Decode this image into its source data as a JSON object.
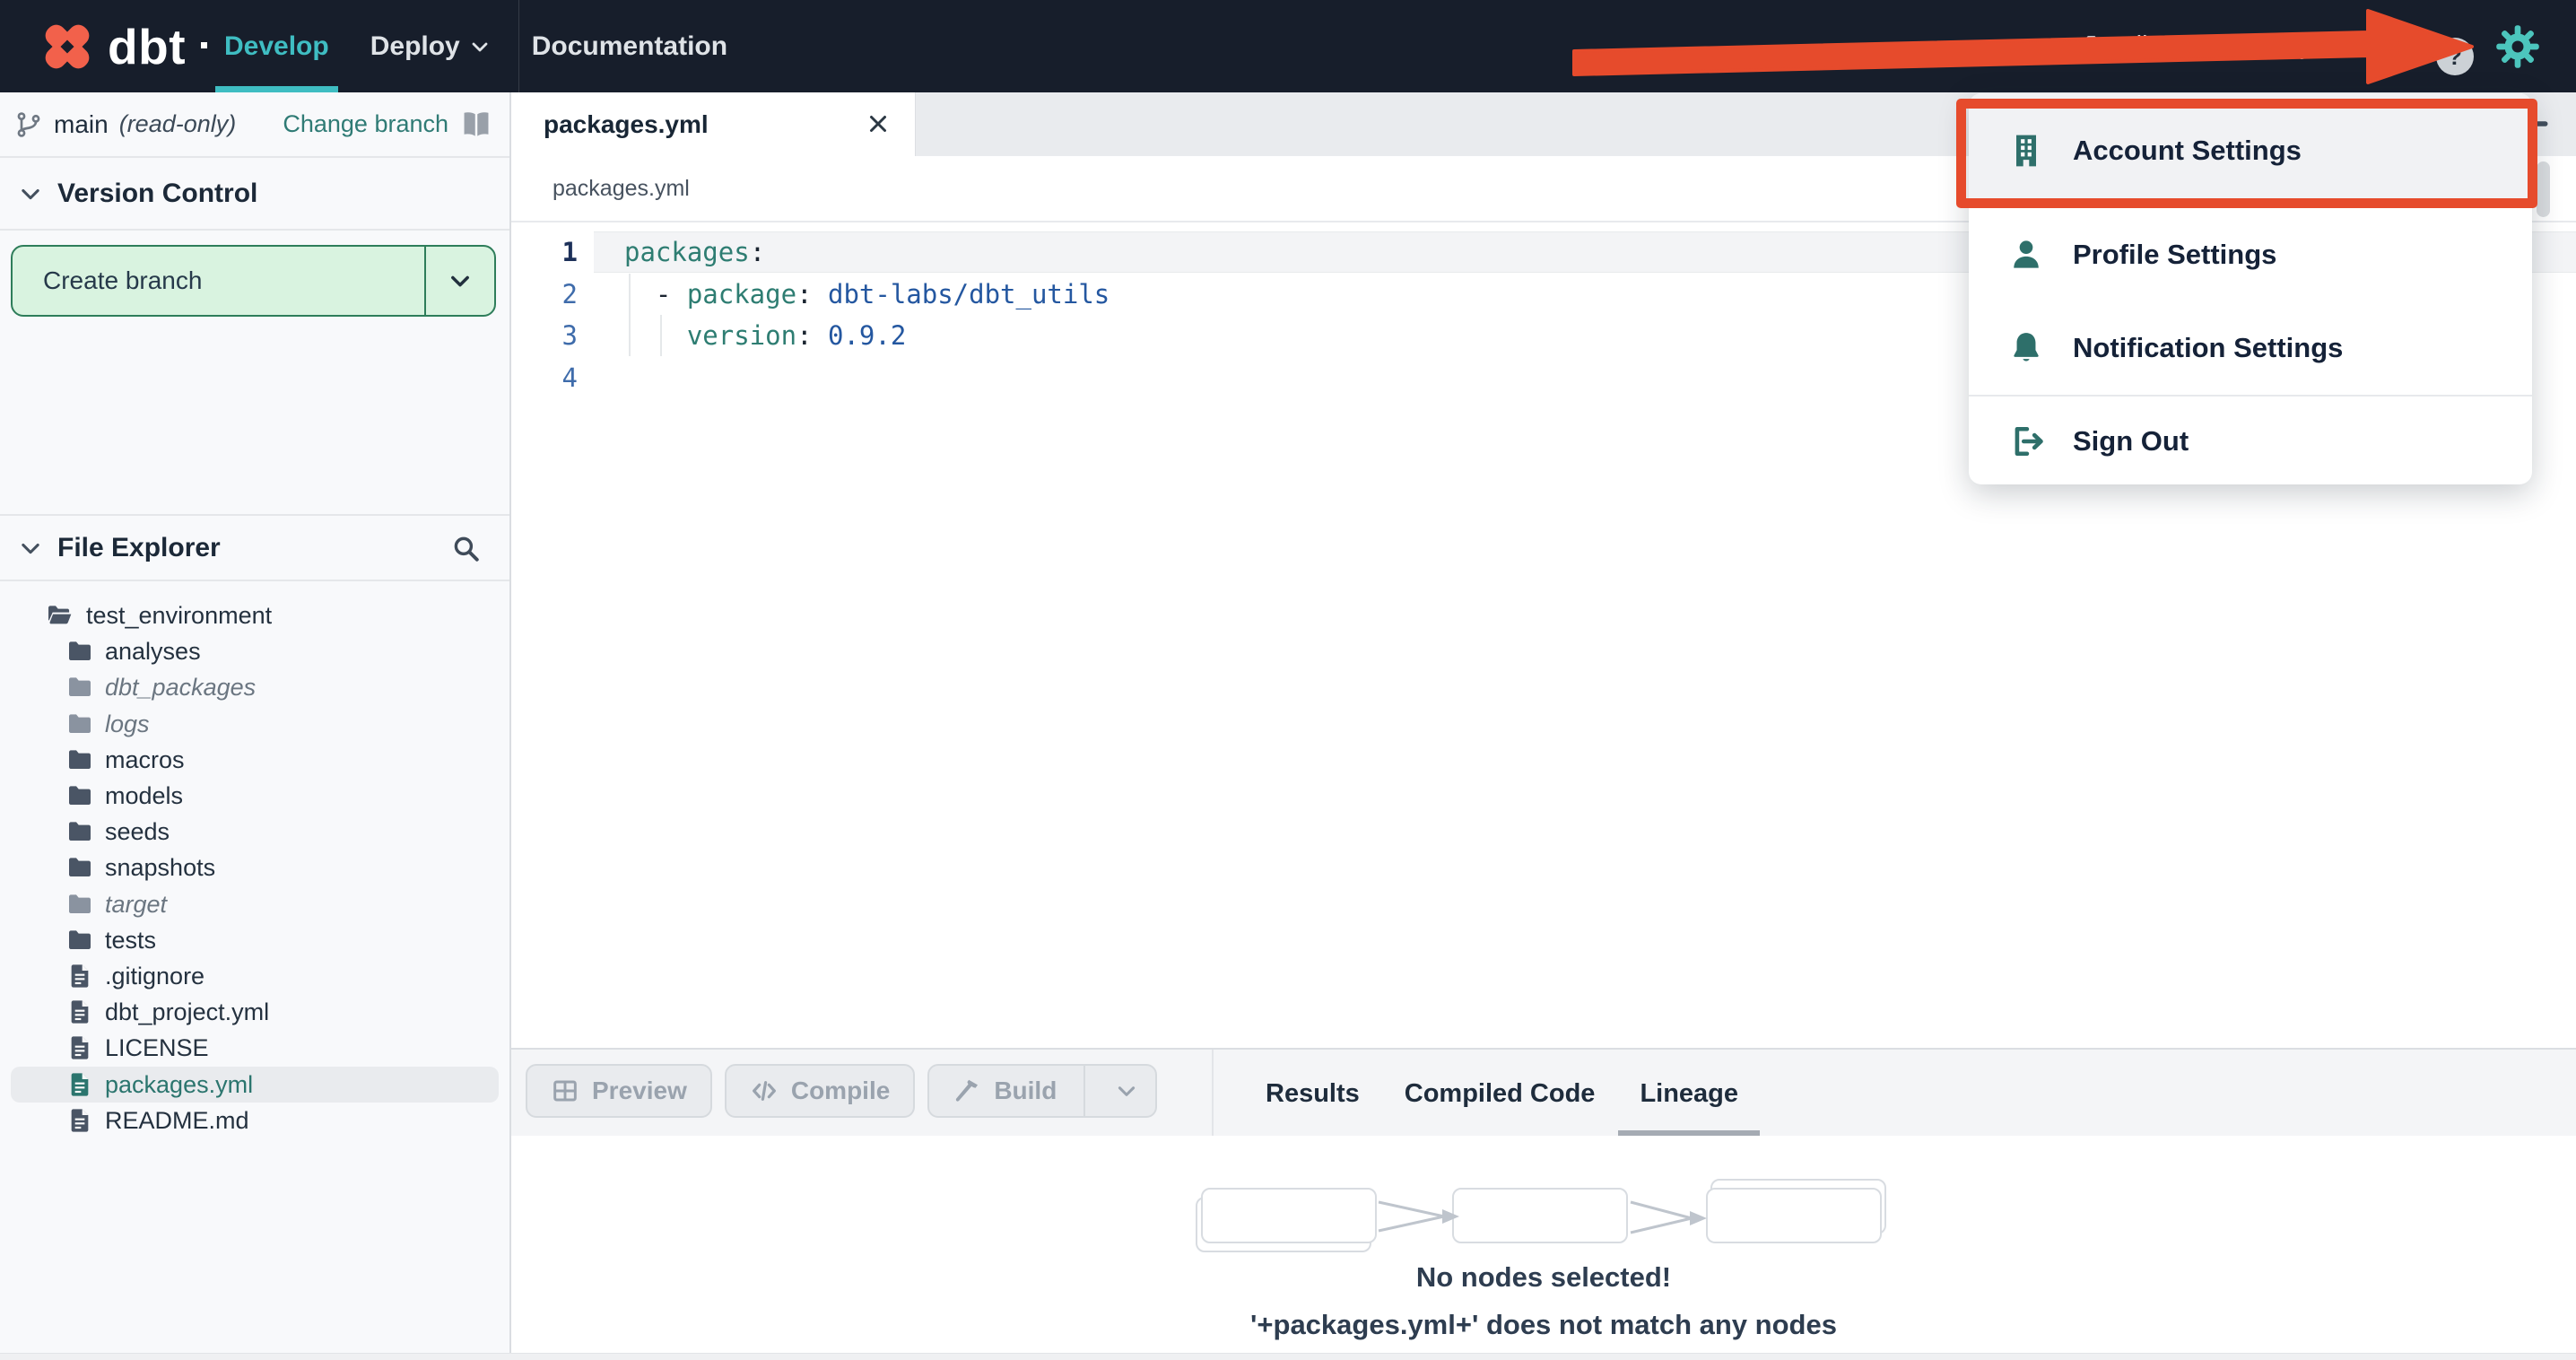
{
  "colors": {
    "navbar_bg": "#171e2b",
    "accent_teal": "#3fbdc2",
    "gear_teal": "#4cc5bd",
    "menu_icon_teal": "#2e6f6a",
    "annotation_red": "#e64b2c",
    "brand_orange": "#f2614b",
    "create_branch_bg": "#d9f3e0",
    "create_branch_border": "#2e7d5a",
    "code_key": "#2e7d72",
    "code_value": "#2457a0"
  },
  "navbar": {
    "logo_text": "dbt",
    "items": [
      {
        "label": "Develop",
        "active": true
      },
      {
        "label": "Deploy",
        "chevron": true
      },
      {
        "label": "Documentation"
      }
    ],
    "breadcrumb": "dbt Labs / Analytics",
    "help_label": "?"
  },
  "sidebar": {
    "branch": {
      "name": "main",
      "mode": "(read-only)",
      "change_label": "Change branch"
    },
    "version_control_title": "Version Control",
    "create_branch_label": "Create branch",
    "file_explorer_title": "File Explorer",
    "tree": [
      {
        "label": "test_environment",
        "icon": "folder-open",
        "depth": 0
      },
      {
        "label": "analyses",
        "icon": "folder",
        "depth": 1
      },
      {
        "label": "dbt_packages",
        "icon": "folder",
        "depth": 1,
        "italic": true
      },
      {
        "label": "logs",
        "icon": "folder",
        "depth": 1,
        "italic": true
      },
      {
        "label": "macros",
        "icon": "folder",
        "depth": 1
      },
      {
        "label": "models",
        "icon": "folder",
        "depth": 1
      },
      {
        "label": "seeds",
        "icon": "folder",
        "depth": 1
      },
      {
        "label": "snapshots",
        "icon": "folder",
        "depth": 1
      },
      {
        "label": "target",
        "icon": "folder",
        "depth": 1,
        "italic": true
      },
      {
        "label": "tests",
        "icon": "folder",
        "depth": 1
      },
      {
        "label": ".gitignore",
        "icon": "file",
        "depth": 1
      },
      {
        "label": "dbt_project.yml",
        "icon": "file",
        "depth": 1
      },
      {
        "label": "LICENSE",
        "icon": "file",
        "depth": 1
      },
      {
        "label": "packages.yml",
        "icon": "file",
        "depth": 1,
        "selected": true
      },
      {
        "label": "README.md",
        "icon": "file",
        "depth": 1
      }
    ]
  },
  "editor": {
    "tab_title": "packages.yml",
    "breadcrumb": "packages.yml",
    "code_lines": [
      {
        "n": "1",
        "current": true,
        "tokens": [
          [
            "packages",
            "key"
          ],
          [
            ":",
            "punc"
          ]
        ]
      },
      {
        "n": "2",
        "tokens": [
          [
            "  - ",
            "punc"
          ],
          [
            "package",
            "key"
          ],
          [
            ": ",
            "punc"
          ],
          [
            "dbt-labs/dbt_utils",
            "val"
          ]
        ]
      },
      {
        "n": "3",
        "tokens": [
          [
            "    ",
            "punc"
          ],
          [
            "version",
            "key"
          ],
          [
            ": ",
            "punc"
          ],
          [
            "0.9.2",
            "val"
          ]
        ]
      },
      {
        "n": "4",
        "tokens": []
      }
    ]
  },
  "bottom": {
    "buttons": [
      {
        "label": "Preview",
        "icon": "grid",
        "disabled": true
      },
      {
        "label": "Compile",
        "icon": "code",
        "disabled": true
      },
      {
        "label": "Build",
        "icon": "hammer",
        "disabled": true,
        "split": true
      }
    ],
    "tabs": [
      {
        "label": "Results"
      },
      {
        "label": "Compiled Code"
      },
      {
        "label": "Lineage",
        "active": true
      }
    ],
    "lineage_placeholder_nodes": 3,
    "lineage_message_title": "No nodes selected!",
    "lineage_message_detail": "'+packages.yml+' does not match any nodes"
  },
  "user_menu": {
    "items": [
      {
        "label": "Account Settings",
        "icon": "building",
        "highlighted": true
      },
      {
        "label": "Profile Settings",
        "icon": "person"
      },
      {
        "label": "Notification Settings",
        "icon": "bell"
      },
      {
        "label": "Sign Out",
        "icon": "sign-out",
        "divider_before": true
      }
    ]
  }
}
